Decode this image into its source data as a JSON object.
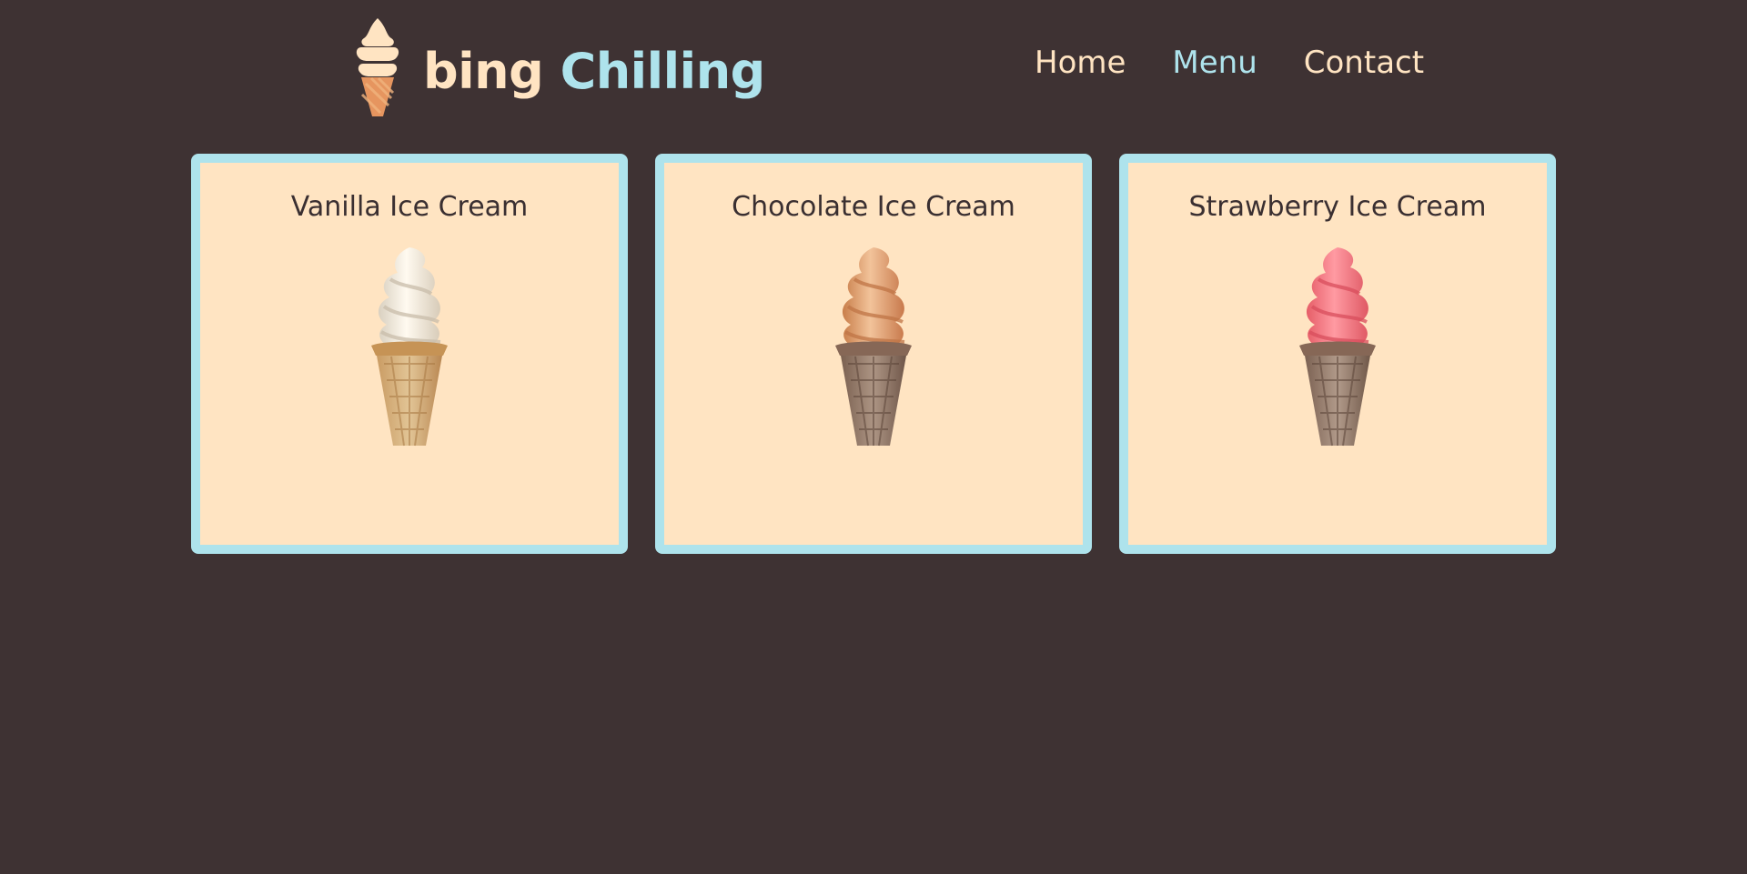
{
  "brand": {
    "word_1": "bing",
    "word_2": "Chilling",
    "colors": {
      "cream": "#ffe4c2",
      "blue": "#aee3ec",
      "background": "#3e3233",
      "orange": "#e6955f"
    }
  },
  "nav": {
    "items": [
      {
        "label": "Home",
        "active": false
      },
      {
        "label": "Menu",
        "active": true
      },
      {
        "label": "Contact",
        "active": false
      }
    ]
  },
  "cards": [
    {
      "title": "Vanilla Ice Cream",
      "image": "vanilla-ice-cream-cone",
      "colors": {
        "swirl": "#f8f2e8",
        "cone": "#d6b27f"
      }
    },
    {
      "title": "Chocolate Ice Cream",
      "image": "chocolate-ice-cream-cone",
      "colors": {
        "swirl": "#e9ad7c",
        "cone": "#9c8170"
      }
    },
    {
      "title": "Strawberry Ice Cream",
      "image": "strawberry-ice-cream-cone",
      "colors": {
        "swirl": "#f57f87",
        "cone": "#9b7f6d"
      }
    }
  ]
}
